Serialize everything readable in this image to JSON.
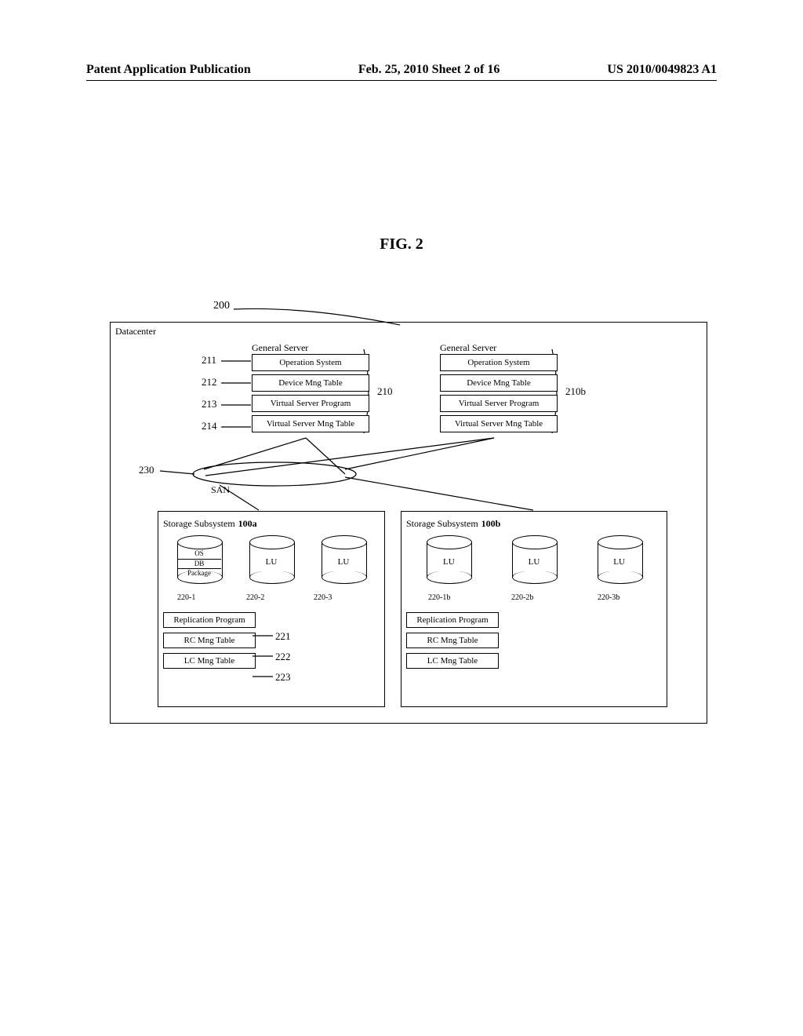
{
  "header": {
    "left": "Patent Application Publication",
    "middle": "Feb. 25, 2010  Sheet 2 of 16",
    "right": "US 2010/0049823 A1"
  },
  "fig_title": "FIG. 2",
  "labels": {
    "dc_num": "200",
    "dc_title": "Datacenter",
    "server_a_title": "General Server",
    "server_b_title": "General Server",
    "srv_items": {
      "os": "Operation System",
      "dev": "Device Mng Table",
      "vsp": "Virtual Server Program",
      "vsmt": "Virtual Server Mng Table"
    },
    "ref": {
      "r211": "211",
      "r212": "212",
      "r213": "213",
      "r214": "214",
      "r210": "210",
      "r210b": "210b",
      "r230": "230",
      "san": "SAN",
      "r100a": "100a",
      "r100b": "100b",
      "r221": "221",
      "r222": "222",
      "r223": "223"
    },
    "storage_a_title": "Storage Subsystem",
    "storage_b_title": "Storage Subsystem",
    "lu": "LU",
    "cyl1": {
      "l1": "OS",
      "l2": "DB",
      "l3": "Package"
    },
    "ids_a": {
      "l1": "220-1",
      "l2": "220-2",
      "l3": "220-3"
    },
    "ids_b": {
      "l1": "220-1b",
      "l2": "220-2b",
      "l3": "220-3b"
    },
    "prog": {
      "rep": "Replication Program",
      "rc": "RC Mng Table",
      "lc": "LC Mng Table"
    }
  }
}
